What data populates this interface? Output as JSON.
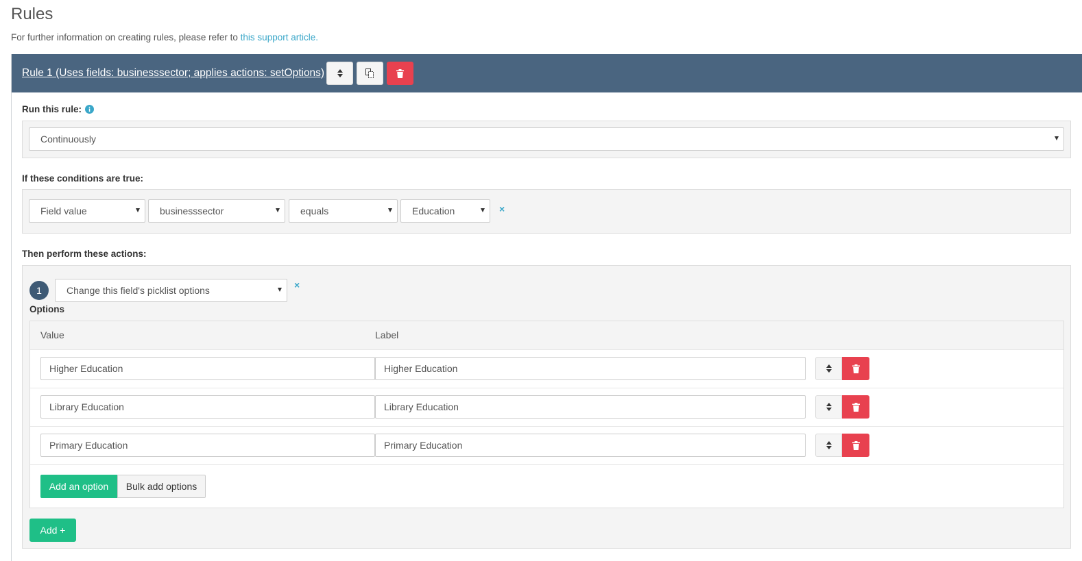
{
  "page": {
    "title": "Rules",
    "intro_text": "For further information on creating rules, please refer to ",
    "intro_link": "this support article."
  },
  "rule": {
    "header_label": "Rule 1 (Uses fields: businesssector; applies actions: setOptions)",
    "run_label": "Run this rule:",
    "run_value": "Continuously",
    "conditions_label": "If these conditions are true:",
    "condition": {
      "type": "Field value",
      "field": "businesssector",
      "operator": "equals",
      "value": "Education",
      "remove": "×"
    },
    "actions_label": "Then perform these actions:",
    "action": {
      "number": "1",
      "type": "Change this field's picklist options",
      "remove": "×",
      "options_label": "Options",
      "columns": {
        "value": "Value",
        "label": "Label"
      },
      "rows": [
        {
          "value": "Higher Education",
          "label": "Higher Education"
        },
        {
          "value": "Library Education",
          "label": "Library Education"
        },
        {
          "value": "Primary Education",
          "label": "Primary Education"
        }
      ],
      "add_option_label": "Add an option",
      "bulk_add_label": "Bulk add options"
    },
    "add_action_label": "Add +"
  },
  "colors": {
    "header_bg": "#4a6580",
    "danger": "#e8414f",
    "success": "#1fbf87",
    "link": "#3aa7c9",
    "badge": "#3e5a75"
  },
  "icons": {
    "sort": "sort-icon",
    "copy": "copy-icon",
    "trash": "trash-icon",
    "info": "info-icon",
    "caret": "caret-down-icon"
  }
}
